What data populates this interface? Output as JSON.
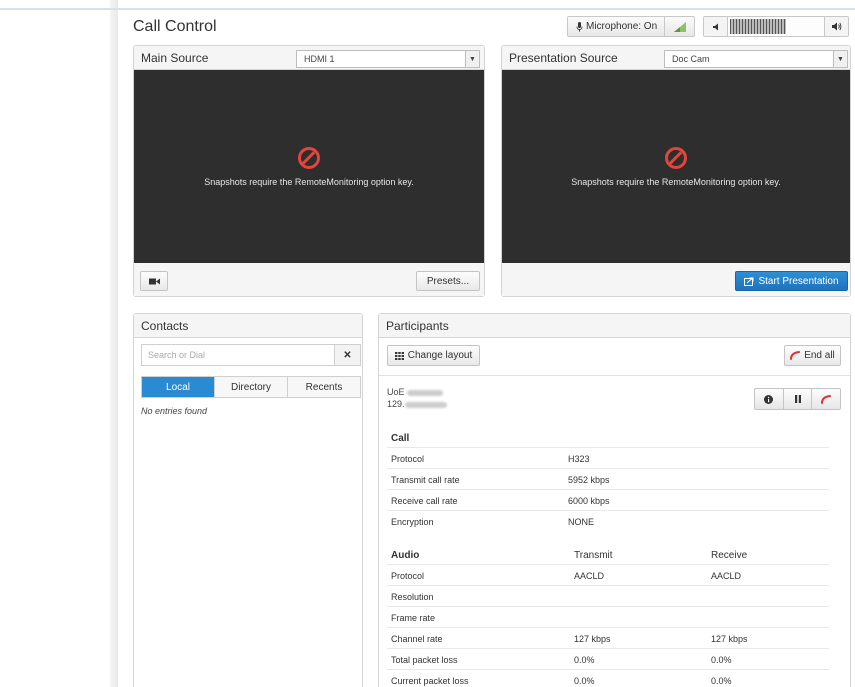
{
  "page": {
    "title": "Call Control"
  },
  "toolbar": {
    "microphone_label": "Microphone: On",
    "volume_down_icon": "volume-down-icon",
    "volume_up_icon": "volume-up-icon",
    "volume_level": 0.6
  },
  "main_source": {
    "title": "Main Source",
    "selected": "HDMI 1",
    "snapshot_message": "Snapshots require the RemoteMonitoring option key.",
    "presets_label": "Presets..."
  },
  "presentation_source": {
    "title": "Presentation Source",
    "selected": "Doc Cam",
    "snapshot_message": "Snapshots require the RemoteMonitoring option key.",
    "start_label": "Start Presentation"
  },
  "contacts": {
    "title": "Contacts",
    "search_placeholder": "Search or Dial",
    "tabs": [
      "Local",
      "Directory",
      "Recents"
    ],
    "active_tab": "Local",
    "empty_text": "No entries found"
  },
  "participants": {
    "title": "Participants",
    "change_layout_label": "Change layout",
    "end_all_label": "End all",
    "caller_name_prefix": "UoE",
    "caller_number_prefix": "129.",
    "call_section": {
      "header": "Call",
      "rows": [
        {
          "label": "Protocol",
          "value": "H323"
        },
        {
          "label": "Transmit call rate",
          "value": "5952 kbps"
        },
        {
          "label": "Receive call rate",
          "value": "6000 kbps"
        },
        {
          "label": "Encryption",
          "value": "NONE"
        }
      ]
    },
    "audio_section": {
      "header": "Audio",
      "transmit_header": "Transmit",
      "receive_header": "Receive",
      "rows": [
        {
          "label": "Protocol",
          "transmit": "AACLD",
          "receive": "AACLD"
        },
        {
          "label": "Resolution",
          "transmit": "",
          "receive": ""
        },
        {
          "label": "Frame rate",
          "transmit": "",
          "receive": ""
        },
        {
          "label": "Channel rate",
          "transmit": "127 kbps",
          "receive": "127 kbps"
        },
        {
          "label": "Total packet loss",
          "transmit": "0.0%",
          "receive": "0.0%"
        },
        {
          "label": "Current packet loss",
          "transmit": "0.0%",
          "receive": "0.0%"
        }
      ]
    }
  },
  "colors": {
    "accent": "#2a8ad2",
    "danger": "#e0463c",
    "video_bg": "#2e2e2e"
  }
}
